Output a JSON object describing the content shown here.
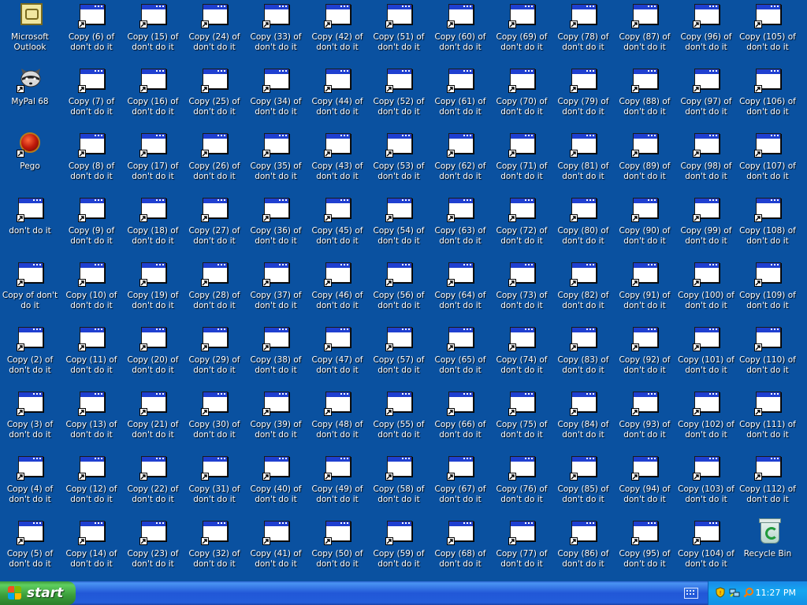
{
  "desktop": {
    "background_color": "#0A51A0",
    "columns": [
      [
        "Microsoft Outlook",
        "MyPal 68",
        "Pego",
        "don't do it",
        "Copy of don't do it",
        "Copy (2) of don't do it",
        "Copy (3) of don't do it",
        "Copy (4) of don't do it",
        "Copy (5) of don't do it"
      ],
      [
        "Copy (6) of don't do it",
        "Copy (7) of don't do it",
        "Copy (8) of don't do it",
        "Copy (9) of don't do it",
        "Copy (10) of don't do it",
        "Copy (11) of don't do it",
        "Copy (13) of don't do it",
        "Copy (12) of don't do it",
        "Copy (14) of don't do it"
      ],
      [
        "Copy (15) of don't do it",
        "Copy (16) of don't do it",
        "Copy (17) of don't do it",
        "Copy (18) of don't do it",
        "Copy (19) of don't do it",
        "Copy (20) of don't do it",
        "Copy (21) of don't do it",
        "Copy (22) of don't do it",
        "Copy (23) of don't do it"
      ],
      [
        "Copy (24) of don't do it",
        "Copy (25) of don't do it",
        "Copy (26) of don't do it",
        "Copy (27) of don't do it",
        "Copy (28) of don't do it",
        "Copy (29) of don't do it",
        "Copy (30) of don't do it",
        "Copy (31) of don't do it",
        "Copy (32) of don't do it"
      ],
      [
        "Copy (33) of don't do it",
        "Copy (34) of don't do it",
        "Copy (35) of don't do it",
        "Copy (36) of don't do it",
        "Copy (37) of don't do it",
        "Copy (38) of don't do it",
        "Copy (39) of don't do it",
        "Copy (40) of don't do it",
        "Copy (41) of don't do it"
      ],
      [
        "Copy (42) of don't do it",
        "Copy (44) of don't do it",
        "Copy (43) of don't do it",
        "Copy (45) of don't do it",
        "Copy (46) of don't do it",
        "Copy (47) of don't do it",
        "Copy (48) of don't do it",
        "Copy (49) of don't do it",
        "Copy (50) of don't do it"
      ],
      [
        "Copy (51) of don't do it",
        "Copy (52) of don't do it",
        "Copy (53) of don't do it",
        "Copy (54) of don't do it",
        "Copy (56) of don't do it",
        "Copy (57) of don't do it",
        "Copy (55) of don't do it",
        "Copy (58) of don't do it",
        "Copy (59) of don't do it"
      ],
      [
        "Copy (60) of don't do it",
        "Copy (61) of don't do it",
        "Copy (62) of don't do it",
        "Copy (63) of don't do it",
        "Copy (64) of don't do it",
        "Copy (65) of don't do it",
        "Copy (66) of don't do it",
        "Copy (67) of don't do it",
        "Copy (68) of don't do it"
      ],
      [
        "Copy (69) of don't do it",
        "Copy (70) of don't do it",
        "Copy (71) of don't do it",
        "Copy (72) of don't do it",
        "Copy (73) of don't do it",
        "Copy (74) of don't do it",
        "Copy (75) of don't do it",
        "Copy (76) of don't do it",
        "Copy (77) of don't do it"
      ],
      [
        "Copy (78) of don't do it",
        "Copy (79) of don't do it",
        "Copy (81) of don't do it",
        "Copy (80) of don't do it",
        "Copy (82) of don't do it",
        "Copy (83) of don't do it",
        "Copy (84) of don't do it",
        "Copy (85) of don't do it",
        "Copy (86) of don't do it"
      ],
      [
        "Copy (87) of don't do it",
        "Copy (88) of don't do it",
        "Copy (89) of don't do it",
        "Copy (90) of don't do it",
        "Copy (91) of don't do it",
        "Copy (92) of don't do it",
        "Copy (93) of don't do it",
        "Copy (94) of don't do it",
        "Copy (95) of don't do it"
      ],
      [
        "Copy (96) of don't do it",
        "Copy (97) of don't do it",
        "Copy (98) of don't do it",
        "Copy (99) of don't do it",
        "Copy (100) of don't do it",
        "Copy (101) of don't do it",
        "Copy (102) of don't do it",
        "Copy (103) of don't do it",
        "Copy (104) of don't do it"
      ],
      [
        "Copy (105) of don't do it",
        "Copy (106) of don't do it",
        "Copy (107) of don't do it",
        "Copy (108) of don't do it",
        "Copy (109) of don't do it",
        "Copy (110) of don't do it",
        "Copy (111) of don't do it",
        "Copy (112) of don't do it",
        "Recycle Bin"
      ]
    ],
    "icon_kinds": {
      "Microsoft Outlook": "outlook-icon",
      "MyPal 68": "mypal-raccoon-icon",
      "Pego": "pego-icon",
      "Recycle Bin": "recycle-bin-icon",
      "default": "window-shortcut-icon"
    }
  },
  "taskbar": {
    "start_label": "start",
    "clock": "11:27 PM",
    "tray_icons": [
      "keyboard-icon",
      "security-shield-icon",
      "network-icon",
      "search-icon"
    ],
    "colors": {
      "taskbar": "#245EDB",
      "start": "#3A9D3A",
      "tray": "#14A6F0"
    }
  }
}
